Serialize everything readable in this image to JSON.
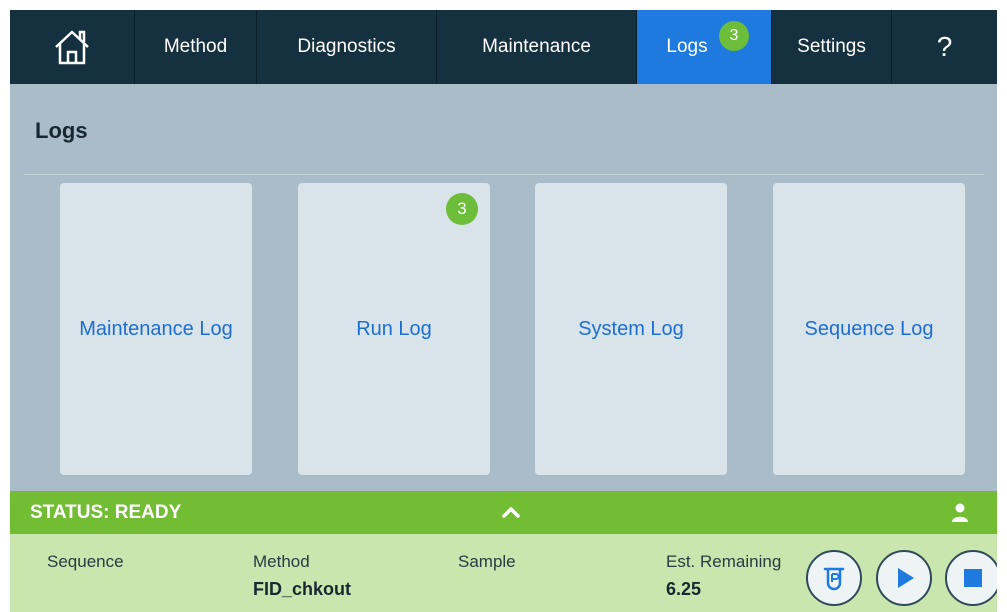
{
  "nav": {
    "items": [
      {
        "label": "Method"
      },
      {
        "label": "Diagnostics"
      },
      {
        "label": "Maintenance"
      },
      {
        "label": "Logs",
        "badge": "3",
        "active": true
      },
      {
        "label": "Settings"
      }
    ],
    "help_label": "?",
    "home_icon": "home-icon"
  },
  "page": {
    "title": "Logs",
    "cards": [
      {
        "label": "Maintenance Log"
      },
      {
        "label": "Run Log",
        "badge": "3"
      },
      {
        "label": "System Log"
      },
      {
        "label": "Sequence Log"
      }
    ]
  },
  "status": {
    "text": "STATUS: READY",
    "chevron_icon": "chevron-up-icon",
    "user_icon": "user-icon"
  },
  "info": {
    "sequence_label": "Sequence",
    "method_label": "Method",
    "method_value": "FID_chkout",
    "sample_label": "Sample",
    "est_label": "Est. Remaining",
    "est_value": "6.25"
  },
  "controls": {
    "vial_icon": "vial-icon",
    "play_icon": "play-icon",
    "stop_icon": "stop-icon"
  },
  "colors": {
    "nav_bg": "#15303f",
    "active_tab": "#1f7ae0",
    "badge": "#6cbd3a",
    "status_green": "#72bd34",
    "info_bg": "#c8e6ad",
    "card_text": "#1c6fd1"
  }
}
